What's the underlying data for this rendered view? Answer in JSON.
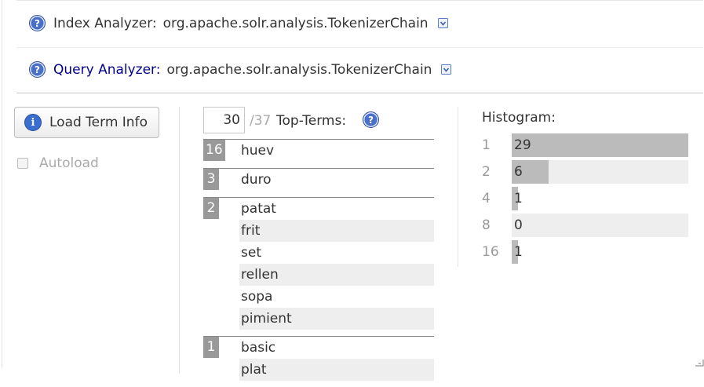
{
  "index_analyzer": {
    "label": "Index Analyzer:",
    "value": "org.apache.solr.analysis.TokenizerChain"
  },
  "query_analyzer": {
    "label": "Query Analyzer:",
    "value": "org.apache.solr.analysis.TokenizerChain"
  },
  "load_term_info": {
    "label": "Load Term Info"
  },
  "autoload": {
    "label": "Autoload",
    "checked": false
  },
  "top_terms": {
    "count_value": "30",
    "total": "/37",
    "label": "Top-Terms:",
    "groups": [
      {
        "count": "16",
        "terms": [
          "huev"
        ]
      },
      {
        "count": "3",
        "terms": [
          "duro"
        ]
      },
      {
        "count": "2",
        "terms": [
          "patat",
          "frit",
          "set",
          "rellen",
          "sopa",
          "pimient"
        ]
      },
      {
        "count": "1",
        "terms": [
          "basic",
          "plat"
        ]
      }
    ]
  },
  "histogram": {
    "title": "Histogram:",
    "max": 29,
    "rows": [
      {
        "key": "1",
        "value": 29
      },
      {
        "key": "2",
        "value": 6
      },
      {
        "key": "4",
        "value": 1
      },
      {
        "key": "8",
        "value": 0
      },
      {
        "key": "16",
        "value": 1
      }
    ]
  },
  "colors": {
    "query_label": "#00008b",
    "histogram_bar": "#bbbbbb",
    "count_badge": "#999999",
    "icon_blue": "#4a6fc8"
  },
  "icons": [
    "help-icon",
    "toggle-down-icon",
    "info-icon",
    "resize-corner-icon"
  ]
}
